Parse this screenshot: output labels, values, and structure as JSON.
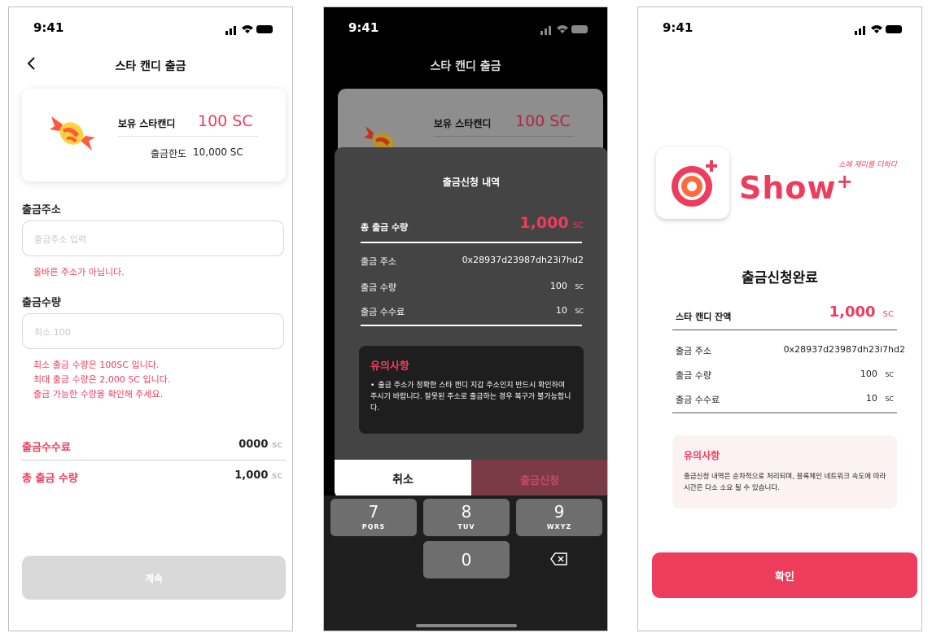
{
  "status": {
    "time": "9:41"
  },
  "screen1": {
    "title": "스타 캔디 출금",
    "balance_label": "보유 스타캔디",
    "balance_value": "100 SC",
    "limit_label": "출금한도",
    "limit_value": "10,000 SC",
    "address_label": "출금주소",
    "address_placeholder": "출금주소 입력",
    "address_error": "올바른 주소가 아닙니다.",
    "amount_label": "출금수량",
    "amount_placeholder": "최소 100",
    "amount_errors": [
      "최소 출금 수량은 100SC 입니다.",
      "최대 출금 수량은 2,000 SC 입니다.",
      "출금 가능한 수량을 확인해 주세요."
    ],
    "fee_label": "출금수수료",
    "fee_value": "0000",
    "total_label": "총 출금 수량",
    "total_value": "1,000",
    "unit": "SC",
    "continue_label": "계속"
  },
  "screen2": {
    "title": "스타 캔디 출금",
    "balance_label": "보유 스타캔디",
    "balance_value": "100 SC",
    "modal_title": "출금신청 내역",
    "total_label": "총 출금 수량",
    "total_value": "1,000",
    "unit": "SC",
    "address_label": "출금 주소",
    "address_value": "0x28937d23987dh23i7hd2",
    "amount_label": "출금 수량",
    "amount_value": "100",
    "fee_label": "출금 수수료",
    "fee_value": "10",
    "notice_title": "유의사항",
    "notice_text": "출금 주소가 정확한 스타 캔디 지갑 주소인지 반드시 확인하여 주시기 바랍니다. 잘못된 주소로 출금하는 경우 복구가 불가능합니다.",
    "cancel_label": "취소",
    "submit_label": "출금신청",
    "keys": [
      {
        "num": "7",
        "letters": "PQRS"
      },
      {
        "num": "8",
        "letters": "TUV"
      },
      {
        "num": "9",
        "letters": "WXYZ"
      },
      {
        "num": "0",
        "letters": ""
      }
    ]
  },
  "screen3": {
    "logo_text": "Show",
    "logo_plus": "+",
    "logo_tagline": "쇼에 재미를 더하다",
    "complete_title": "출금신청완료",
    "balance_label": "스타 캔디 잔액",
    "balance_value": "1,000",
    "unit": "SC",
    "address_label": "출금 주소",
    "address_value": "0x28937d23987dh23i7hd2",
    "amount_label": "출금 수량",
    "amount_value": "100",
    "fee_label": "출금 수수료",
    "fee_value": "10",
    "notice_title": "유의사항",
    "notice_text": "출금신청 내역은 순차적으로 처리되며, 블록체인 네트워크 속도에 따라 시간은 다소 소요 될 수 있습니다.",
    "confirm_label": "확인"
  },
  "colors": {
    "accent": "#ee3d5c",
    "modal": "#444444",
    "submit_dim": "#7a3a46"
  }
}
